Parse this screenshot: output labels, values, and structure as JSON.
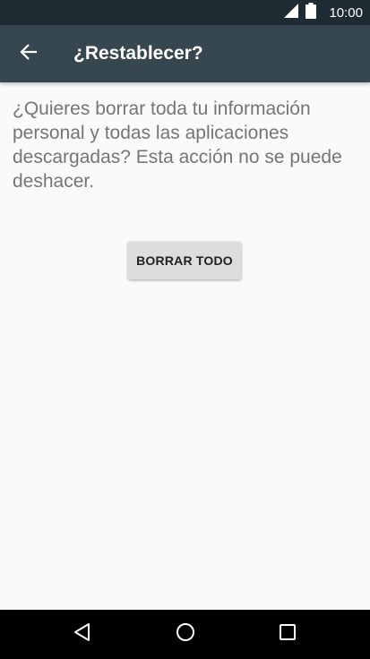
{
  "status_bar": {
    "time": "10:00",
    "icons": [
      "signal-icon",
      "battery-icon"
    ]
  },
  "app_bar": {
    "title": "¿Restablecer?",
    "back_icon": "arrow-back-icon"
  },
  "content": {
    "message": "¿Quieres borrar toda tu información personal y todas las aplicaciones descargadas? Esta acción no se puede deshacer.",
    "erase_button_label": "BORRAR TODO"
  },
  "nav_bar": {
    "buttons": [
      "back-triangle-icon",
      "home-circle-icon",
      "recents-square-icon"
    ]
  },
  "colors": {
    "status_bar": "#1f2b32",
    "app_bar": "#37474f",
    "background": "#fafafa",
    "message_text": "#757575",
    "button_bg": "#dddddd",
    "nav_bar": "#000000"
  }
}
